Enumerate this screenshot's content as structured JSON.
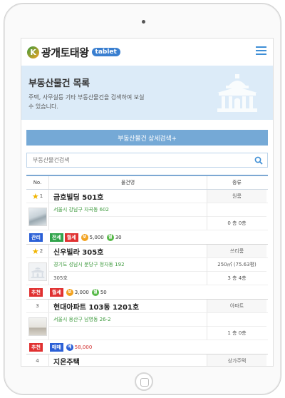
{
  "header": {
    "logo_letter": "K",
    "logo_text": "광개토태왕",
    "badge": "tablet"
  },
  "banner": {
    "title": "부동산물건 목록",
    "desc": "주택, 사무실등 기타 부동산물건을 검색하여 보실 수 있습니다."
  },
  "detail_search_label": "부동산물건 상세검색+",
  "search": {
    "placeholder": "부동산물건검색"
  },
  "table": {
    "headers": {
      "no": "No.",
      "name": "물건명",
      "type": "종류"
    },
    "rows": [
      {
        "no": "1",
        "title": "금호빌딩 501호",
        "type": "원룸",
        "address": "서울시 강남구 자곡동 602",
        "sub": "",
        "area": "",
        "floor": "0 층 0층",
        "tags": [
          {
            "label": "관리",
            "color": "blue"
          },
          {
            "label": "전세",
            "color": "green"
          },
          {
            "label": "월세",
            "color": "red"
          }
        ],
        "prices": [
          {
            "icon": "보",
            "kind": "orange",
            "value": "5,000"
          },
          {
            "icon": "월",
            "kind": "green",
            "value": "30"
          }
        ]
      },
      {
        "no": "2",
        "title": "신우빌라 305호",
        "type": "쓰리룸",
        "address": "경기도 성남시 분당구 정자동 192",
        "sub": "305호",
        "area": "250㎡ (75.63평)",
        "floor": "3 층 4층",
        "tags": [
          {
            "label": "추천",
            "color": "red"
          },
          {
            "label": "월세",
            "color": "red"
          }
        ],
        "prices": [
          {
            "icon": "보",
            "kind": "orange",
            "value": "3,000"
          },
          {
            "icon": "월",
            "kind": "green",
            "value": "50"
          }
        ]
      },
      {
        "no": "3",
        "title": "현대아파트 103동 1201호",
        "type": "아파트",
        "address": "서울시 용산구 남영동 26-2",
        "sub": "",
        "area": "",
        "floor": "1 층 0층",
        "tags": [
          {
            "label": "추천",
            "color": "red"
          },
          {
            "label": "매매",
            "color": "blue"
          }
        ],
        "prices": [
          {
            "icon": "매",
            "kind": "blue",
            "value": "58,000"
          }
        ]
      },
      {
        "no": "4",
        "title": "지온주택",
        "type": "상가주택"
      }
    ]
  }
}
